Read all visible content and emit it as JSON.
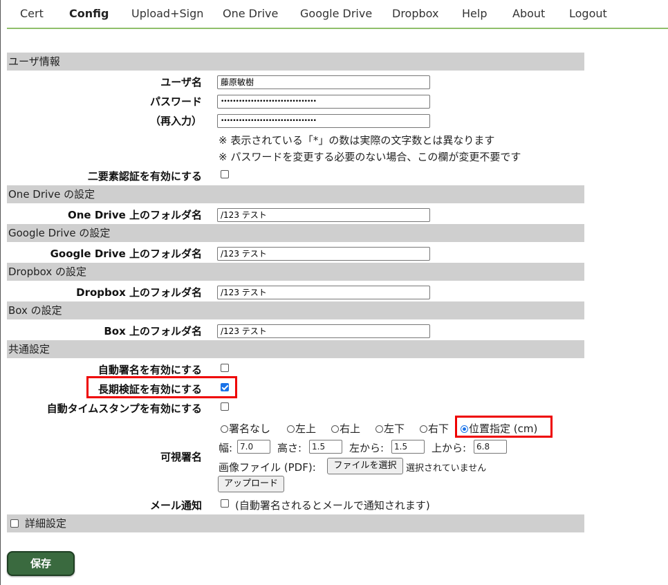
{
  "nav": [
    {
      "label": "Cert"
    },
    {
      "label": "Config"
    },
    {
      "label": "Upload+Sign"
    },
    {
      "label": "One Drive"
    },
    {
      "label": "Google Drive"
    },
    {
      "label": "Dropbox"
    },
    {
      "label": "Help"
    },
    {
      "label": "About"
    },
    {
      "label": "Logout"
    }
  ],
  "user": {
    "section": "ユーザ情報",
    "username_label": "ユーザ名",
    "username_value": "藤原敏樹",
    "password_label": "パスワード",
    "password_value": "••••••••••••••••••••••••••••••••",
    "reenter_label": "（再入力）",
    "reenter_value": "••••••••••••••••••••••••••••••••",
    "note1": "※ 表示されている「*」の数は実際の文字数とは異なります",
    "note2": "※ パスワードを変更する必要のない場合、この欄が変更不要です",
    "twofactor_label": "二要素認証を有効にする"
  },
  "onedrive": {
    "section": "One Drive の設定",
    "label": "One Drive 上のフォルダ名",
    "value": "/123 テスト"
  },
  "googledrive": {
    "section": "Google Drive の設定",
    "label": "Google Drive 上のフォルダ名",
    "value": "/123 テスト"
  },
  "dropbox": {
    "section": "Dropbox の設定",
    "label": "Dropbox 上のフォルダ名",
    "value": "/123 テスト"
  },
  "box": {
    "section": "Box の設定",
    "label": "Box 上のフォルダ名",
    "value": "/123 テスト"
  },
  "common": {
    "section": "共通設定",
    "autosign_label": "自動署名を有効にする",
    "ltv_label": "長期検証を有効にする",
    "timestamp_label": "自動タイムスタンプを有効にする",
    "visible_label": "可視署名",
    "radios": [
      {
        "label": "署名なし"
      },
      {
        "label": "左上"
      },
      {
        "label": "右上"
      },
      {
        "label": "左下"
      },
      {
        "label": "右下"
      },
      {
        "label": "位置指定 (cm)"
      }
    ],
    "width_label": "幅:",
    "width_value": "7.0",
    "height_label": "高さ:",
    "height_value": "1.5",
    "left_label": "左から:",
    "left_value": "1.5",
    "top_label": "上から:",
    "top_value": "6.8",
    "image_label": "画像ファイル (PDF):",
    "file_button": "ファイルを選択",
    "file_status": "選択されていません",
    "upload_button": "アップロード",
    "mail_label": "メール通知",
    "mail_note": "(自動署名されるとメールで通知されます)"
  },
  "advanced": {
    "label": "詳細設定"
  },
  "save_button": "保存"
}
